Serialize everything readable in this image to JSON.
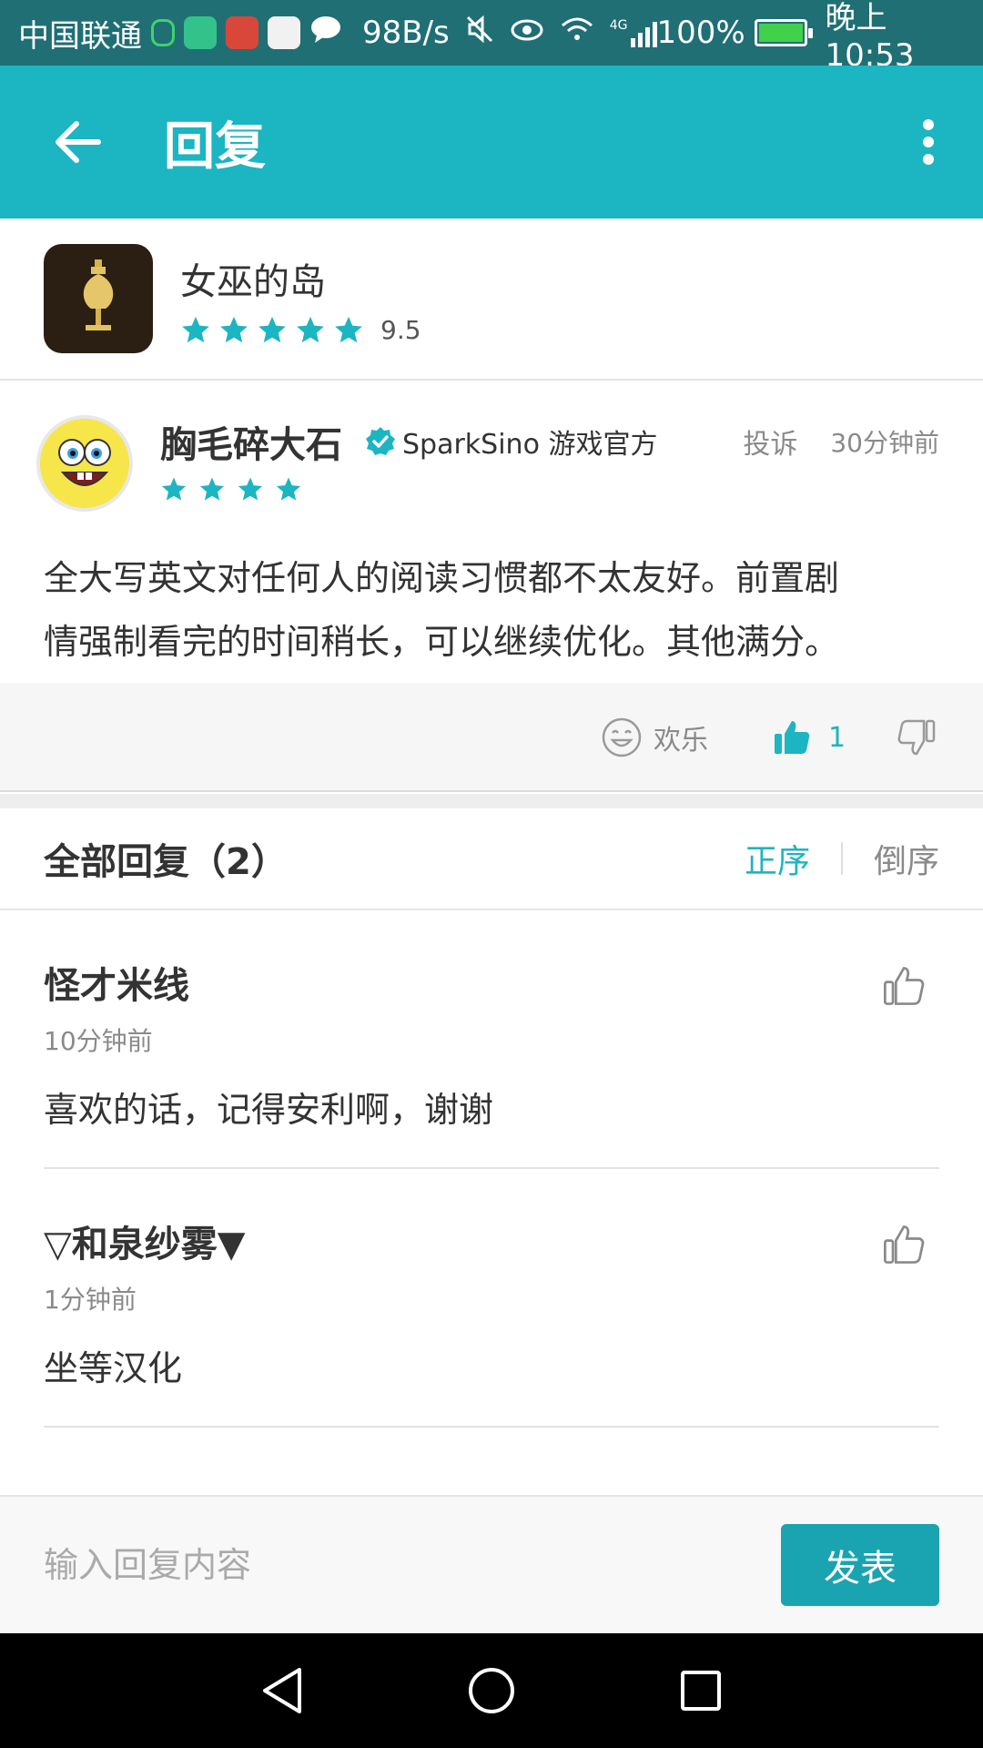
{
  "status_bar": {
    "carrier": "中国联通",
    "net_speed": "98B/s",
    "signal_type": "4G",
    "battery": "100%",
    "time": "晚上10:53"
  },
  "app_bar": {
    "title": "回复",
    "back_icon": "arrow-left-icon",
    "more_icon": "more-vertical-icon"
  },
  "game": {
    "name": "女巫的岛",
    "score": "9.5",
    "stars": 5
  },
  "review": {
    "username": "胸毛碎大石",
    "verified_label": "SparkSino 游戏官方",
    "report_label": "投诉",
    "time": "30分钟前",
    "stars": 4,
    "text_line1": "全大写英文对任何人的阅读习惯都不太友好。前置剧",
    "text_line2": "情强制看完的时间稍长，可以继续优化。其他满分。"
  },
  "reactions": {
    "fun_label": "欢乐",
    "like_count": "1"
  },
  "replies_header": {
    "title": "全部回复（2）",
    "sort_asc": "正序",
    "sort_desc": "倒序"
  },
  "replies": [
    {
      "name": "怪才米线",
      "time": "10分钟前",
      "text": "喜欢的话，记得安利啊，谢谢"
    },
    {
      "name": "▽和泉纱雾▼",
      "time": "1分钟前",
      "text": "坐等汉化"
    }
  ],
  "input_bar": {
    "placeholder": "输入回复内容",
    "send_label": "发表"
  },
  "colors": {
    "primary": "#1cb5c2",
    "status_bar": "#1f6f75",
    "send_button": "#1aa3b0"
  }
}
